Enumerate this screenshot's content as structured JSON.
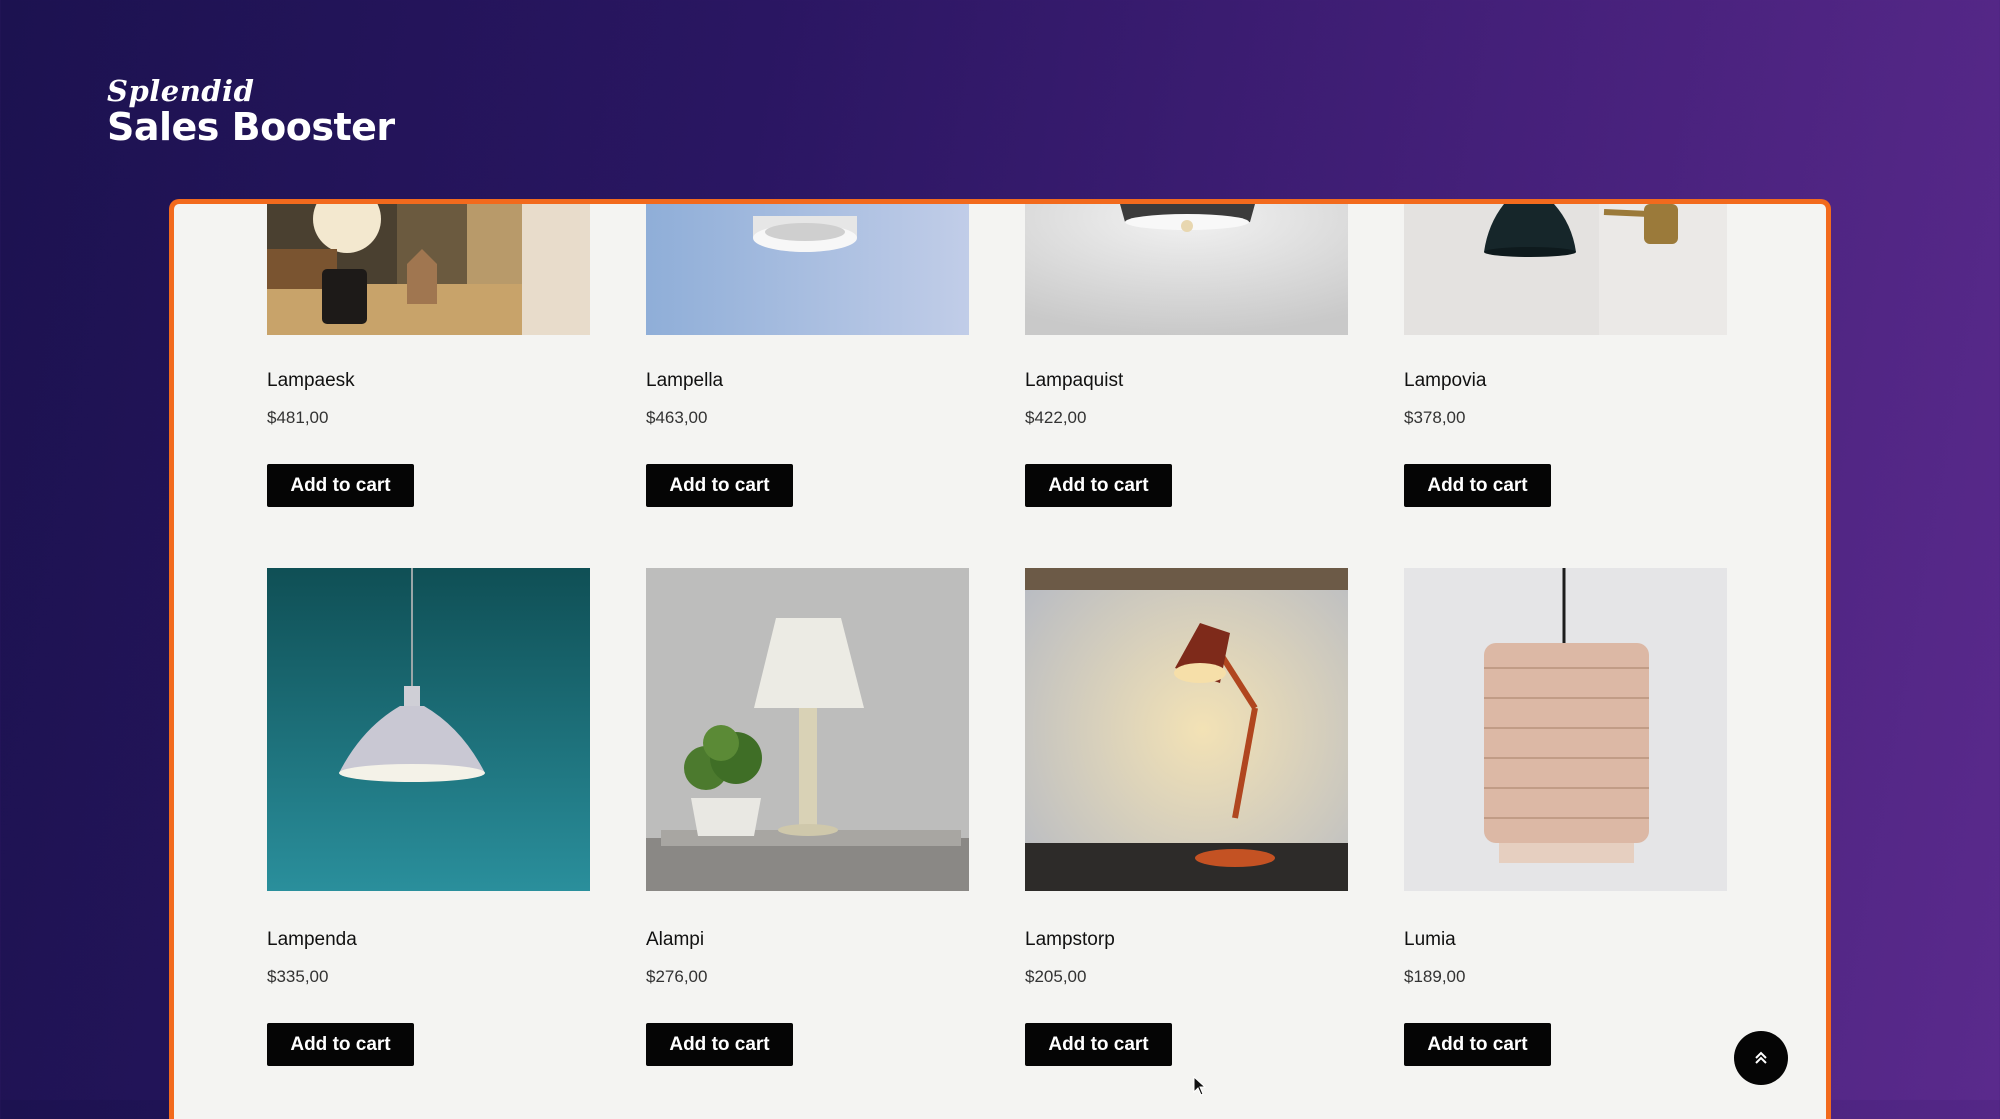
{
  "brand": {
    "script": "Splendid",
    "title": "Sales Booster"
  },
  "products": [
    {
      "name": "Lampaesk",
      "price": "$481,00",
      "button": "Add to cart"
    },
    {
      "name": "Lampella",
      "price": "$463,00",
      "button": "Add to cart"
    },
    {
      "name": "Lampaquist",
      "price": "$422,00",
      "button": "Add to cart"
    },
    {
      "name": "Lampovia",
      "price": "$378,00",
      "button": "Add to cart"
    },
    {
      "name": "Lampenda",
      "price": "$335,00",
      "button": "Add to cart"
    },
    {
      "name": "Alampi",
      "price": "$276,00",
      "button": "Add to cart"
    },
    {
      "name": "Lampstorp",
      "price": "$205,00",
      "button": "Add to cart"
    },
    {
      "name": "Lumia",
      "price": "$189,00",
      "button": "Add to cart"
    }
  ],
  "icons": {
    "scroll_top": "double-chevron-up-icon",
    "cursor": "mouse-pointer-icon"
  },
  "colors": {
    "panel_border": "#f26a1d",
    "button_bg": "#050505",
    "panel_bg": "#f4f4f2"
  }
}
